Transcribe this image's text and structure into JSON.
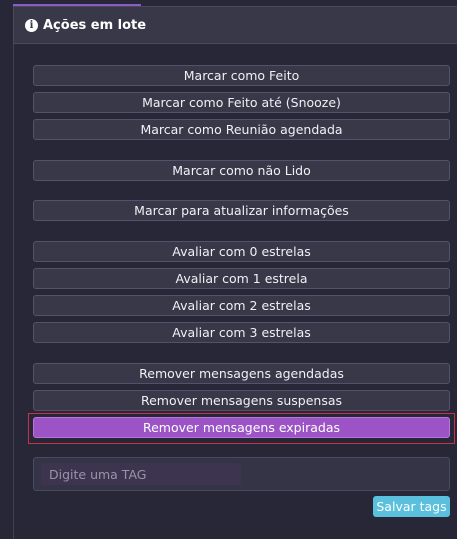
{
  "panel": {
    "title": "Ações em lote",
    "icon": "info-icon"
  },
  "actions": [
    "Marcar como Feito",
    "Marcar como Feito até (Snooze)",
    "Marcar como Reunião agendada",
    "Marcar como não Lido",
    "Marcar para atualizar informações",
    "Avaliar com 0 estrelas",
    "Avaliar com 1 estrela",
    "Avaliar com 2 estrelas",
    "Avaliar com 3 estrelas",
    "Remover mensagens agendadas",
    "Remover mensagens suspensas",
    "Remover mensagens expiradas"
  ],
  "tag": {
    "placeholder": "Digite uma TAG",
    "value": "",
    "save_label": "Salvar tags"
  },
  "colors": {
    "background": "#272737",
    "accent": "#9c53c6",
    "save_button": "#5bc0de",
    "focus_outline": "#c8334a"
  }
}
